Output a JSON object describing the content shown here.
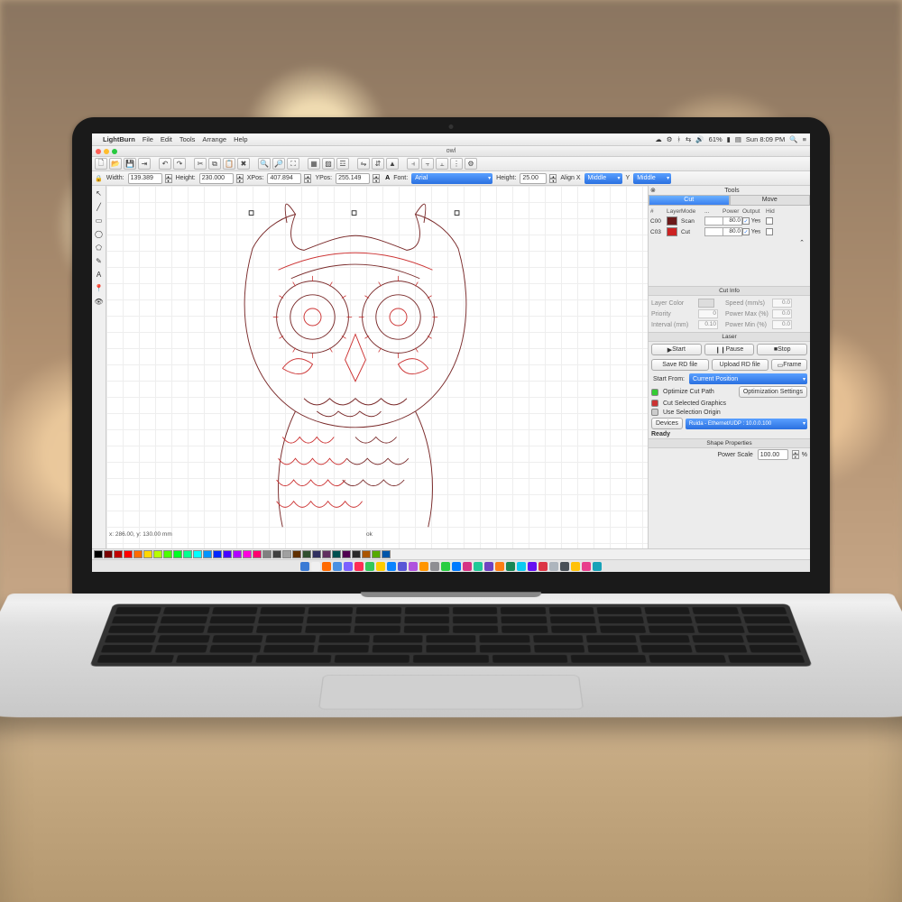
{
  "menubar": {
    "app": "LightBurn",
    "items": [
      "File",
      "Edit",
      "Tools",
      "Arrange",
      "Help"
    ],
    "battery": "61%",
    "clock": "Sun 8:09 PM"
  },
  "window": {
    "doc_title": "owl"
  },
  "props": {
    "lock": "🔒",
    "width_label": "Width:",
    "width": "139.389",
    "height_label": "Height:",
    "height": "230.000",
    "xpos_label": "XPos:",
    "xpos": "407.894",
    "ypos_label": "YPos:",
    "ypos": "255.149",
    "font_label": "Font:",
    "font": "Arial",
    "fheight_label": "Height:",
    "fheight": "25.00",
    "alignx_label": "Align X",
    "alignx": "Middle",
    "aligny_label": "Y",
    "aligny": "Middle"
  },
  "rpanel": {
    "tools_title": "Tools",
    "tabs": {
      "cut": "Cut",
      "move": "Move"
    },
    "cols": {
      "num": "#",
      "layer": "Layer",
      "mode": "Mode",
      "spd": "...",
      "power": "Power",
      "output": "Output",
      "hid": "Hid"
    },
    "layers": [
      {
        "id": "C00",
        "color": "#6b1a1a",
        "mode": "Scan",
        "power": "80.0",
        "output": "Yes"
      },
      {
        "id": "C03",
        "color": "#cc2222",
        "mode": "Cut",
        "power": "80.0",
        "output": "Yes"
      }
    ],
    "cutinfo": {
      "title": "Cut Info",
      "layer_color": "Layer Color",
      "speed": "Speed  (mm/s)",
      "speed_v": "0.0",
      "priority": "Priority",
      "priority_v": "0",
      "powermax": "Power Max (%)",
      "powermax_v": "0.0",
      "interval": "Interval (mm)",
      "interval_v": "0.10",
      "powermin": "Power Min (%)",
      "powermin_v": "0.0"
    },
    "laser": {
      "title": "Laser",
      "start": "Start",
      "pause": "Pause",
      "stop": "Stop",
      "save": "Save RD file",
      "upload": "Upload RD file",
      "frame": "Frame",
      "start_from": "Start From:",
      "start_from_v": "Current Position",
      "opt_path": "Optimize Cut Path",
      "opt_settings": "Optimization Settings",
      "cut_sel": "Cut Selected Graphics",
      "use_sel": "Use Selection Origin",
      "devices": "Devices",
      "device_v": "Ruida - Ethernet/UDP : 10.0.0.100",
      "ready": "Ready"
    },
    "shape": {
      "title": "Shape Properties",
      "pscale": "Power Scale",
      "pscale_v": "100.00",
      "pct": "%"
    }
  },
  "status": {
    "coords": "x: 286.00, y: 130.00 mm",
    "ok": "ok"
  },
  "palette": [
    "#000000",
    "#780000",
    "#c00000",
    "#ff0000",
    "#ff6a00",
    "#ffd800",
    "#b6ff00",
    "#4cff00",
    "#00ff21",
    "#00ff90",
    "#00ffff",
    "#0094ff",
    "#0026ff",
    "#4800ff",
    "#b200ff",
    "#ff00dc",
    "#ff006e",
    "#808080",
    "#404040",
    "#a0a0a0",
    "#603000",
    "#305030",
    "#303060",
    "#603060",
    "#005050",
    "#500050",
    "#2a2a2a",
    "#aa5500",
    "#55aa00",
    "#0055aa"
  ],
  "dock_colors": [
    "#3a7bd5",
    "#f0f0f0",
    "#ff6a00",
    "#4a90e2",
    "#7b61ff",
    "#ff2d55",
    "#34c759",
    "#ffcc00",
    "#0a84ff",
    "#5856d6",
    "#af52de",
    "#ff9500",
    "#8e8e93",
    "#28cd41",
    "#007aff",
    "#d63384",
    "#20c997",
    "#6f42c1",
    "#fd7e14",
    "#198754",
    "#0dcaf0",
    "#6610f2",
    "#dc3545",
    "#adb5bd",
    "#495057",
    "#ffc107",
    "#e83e8c",
    "#17a2b8"
  ]
}
